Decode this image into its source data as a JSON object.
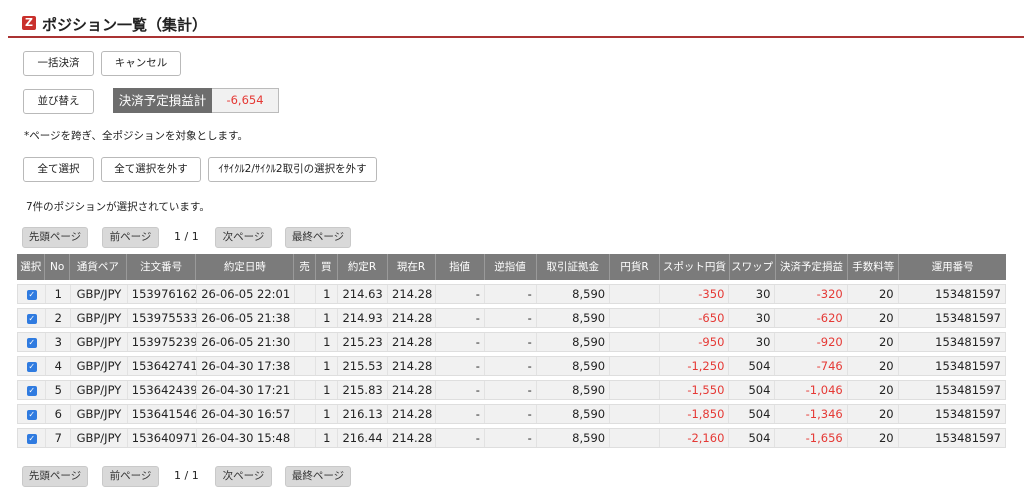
{
  "header": {
    "logo": "Z",
    "title": "ポジション一覧（集計）"
  },
  "actions": {
    "bulk_settle": "一括決済",
    "cancel": "キャンセル",
    "sort": "並び替え",
    "pl_label": "決済予定損益計",
    "pl_value": "-6,654"
  },
  "notice": "*ページを跨ぎ、全ポジションを対象とします。",
  "selection": {
    "select_all": "全て選択",
    "deselect_all": "全て選択を外す",
    "deselect_cycle": "ｲｻｲｸﾙ2/ｻｲｸﾙ2取引の選択を外す",
    "status": "7件のポジションが選択されています。"
  },
  "pager": {
    "first": "先頭ページ",
    "prev": "前ページ",
    "info": "1 / 1",
    "next": "次ページ",
    "last": "最終ページ"
  },
  "table": {
    "headers": [
      "選択",
      "No",
      "通貨ペア",
      "注文番号",
      "約定日時",
      "売",
      "買",
      "約定R",
      "現在R",
      "指値",
      "逆指値",
      "取引証拠金",
      "円貨R",
      "スポット円貨",
      "スワップ",
      "決済予定損益",
      "手数料等",
      "運用番号"
    ],
    "rows": [
      {
        "checked": "✓",
        "no": "1",
        "pair": "GBP/JPY",
        "order": "153976162",
        "date": "26-06-05 22:01",
        "sell": "",
        "buy": "1",
        "rate": "214.63",
        "current": "214.28",
        "limit": "-",
        "stop": "-",
        "margin": "8,590",
        "yen_rate": "",
        "spot": "-350",
        "swap": "30",
        "pl": "-320",
        "fee": "20",
        "op": "153481597"
      },
      {
        "checked": "✓",
        "no": "2",
        "pair": "GBP/JPY",
        "order": "153975533",
        "date": "26-06-05 21:38",
        "sell": "",
        "buy": "1",
        "rate": "214.93",
        "current": "214.28",
        "limit": "-",
        "stop": "-",
        "margin": "8,590",
        "yen_rate": "",
        "spot": "-650",
        "swap": "30",
        "pl": "-620",
        "fee": "20",
        "op": "153481597"
      },
      {
        "checked": "✓",
        "no": "3",
        "pair": "GBP/JPY",
        "order": "153975239",
        "date": "26-06-05 21:30",
        "sell": "",
        "buy": "1",
        "rate": "215.23",
        "current": "214.28",
        "limit": "-",
        "stop": "-",
        "margin": "8,590",
        "yen_rate": "",
        "spot": "-950",
        "swap": "30",
        "pl": "-920",
        "fee": "20",
        "op": "153481597"
      },
      {
        "checked": "✓",
        "no": "4",
        "pair": "GBP/JPY",
        "order": "153642741",
        "date": "26-04-30 17:38",
        "sell": "",
        "buy": "1",
        "rate": "215.53",
        "current": "214.28",
        "limit": "-",
        "stop": "-",
        "margin": "8,590",
        "yen_rate": "",
        "spot": "-1,250",
        "swap": "504",
        "pl": "-746",
        "fee": "20",
        "op": "153481597"
      },
      {
        "checked": "✓",
        "no": "5",
        "pair": "GBP/JPY",
        "order": "153642439",
        "date": "26-04-30 17:21",
        "sell": "",
        "buy": "1",
        "rate": "215.83",
        "current": "214.28",
        "limit": "-",
        "stop": "-",
        "margin": "8,590",
        "yen_rate": "",
        "spot": "-1,550",
        "swap": "504",
        "pl": "-1,046",
        "fee": "20",
        "op": "153481597"
      },
      {
        "checked": "✓",
        "no": "6",
        "pair": "GBP/JPY",
        "order": "153641546",
        "date": "26-04-30 16:57",
        "sell": "",
        "buy": "1",
        "rate": "216.13",
        "current": "214.28",
        "limit": "-",
        "stop": "-",
        "margin": "8,590",
        "yen_rate": "",
        "spot": "-1,850",
        "swap": "504",
        "pl": "-1,346",
        "fee": "20",
        "op": "153481597"
      },
      {
        "checked": "✓",
        "no": "7",
        "pair": "GBP/JPY",
        "order": "153640971",
        "date": "26-04-30 15:48",
        "sell": "",
        "buy": "1",
        "rate": "216.44",
        "current": "214.28",
        "limit": "-",
        "stop": "-",
        "margin": "8,590",
        "yen_rate": "",
        "spot": "-2,160",
        "swap": "504",
        "pl": "-1,656",
        "fee": "20",
        "op": "153481597"
      }
    ]
  },
  "colors": {
    "accent_red": "#c9302c",
    "negative": "#e53935",
    "checkbox_blue": "#2f7be0",
    "header_gray": "#7b7b7b"
  }
}
